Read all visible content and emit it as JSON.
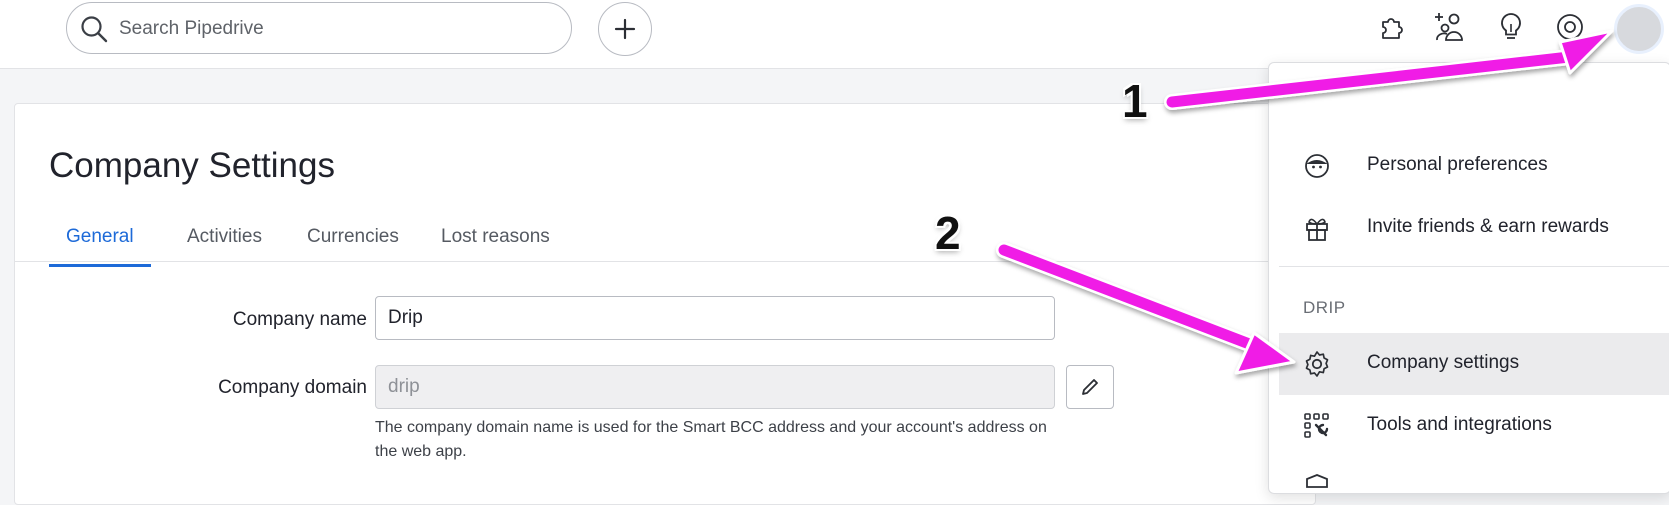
{
  "search": {
    "placeholder": "Search Pipedrive"
  },
  "topbar_icons": [
    "plus-icon",
    "puzzle-icon",
    "add-people-icon",
    "lightbulb-icon",
    "help-icon",
    "user-avatar"
  ],
  "page": {
    "title": "Company Settings",
    "tabs": [
      {
        "label": "General",
        "active": true
      },
      {
        "label": "Activities",
        "active": false
      },
      {
        "label": "Currencies",
        "active": false
      },
      {
        "label": "Lost reasons",
        "active": false
      }
    ]
  },
  "form": {
    "company_name": {
      "label": "Company name",
      "value": "Drip"
    },
    "company_domain": {
      "label": "Company domain",
      "value": "drip",
      "help": "The company domain name is used for the Smart BCC address and your account's address on the web app."
    }
  },
  "menu": {
    "items": [
      {
        "label": "Personal preferences",
        "icon": "face-icon"
      },
      {
        "label": "Invite friends & earn rewards",
        "icon": "gift-icon"
      }
    ],
    "section_label": "DRIP",
    "company_items": [
      {
        "label": "Company settings",
        "icon": "gear-icon",
        "highlighted": true
      },
      {
        "label": "Tools and integrations",
        "icon": "tools-icon",
        "highlighted": false
      }
    ]
  },
  "annotations": {
    "step1": "1",
    "step2": "2",
    "color": "#f01ee6"
  },
  "colors": {
    "accent": "#1d6ad8",
    "annotation_arrow": "#f01ee6"
  }
}
